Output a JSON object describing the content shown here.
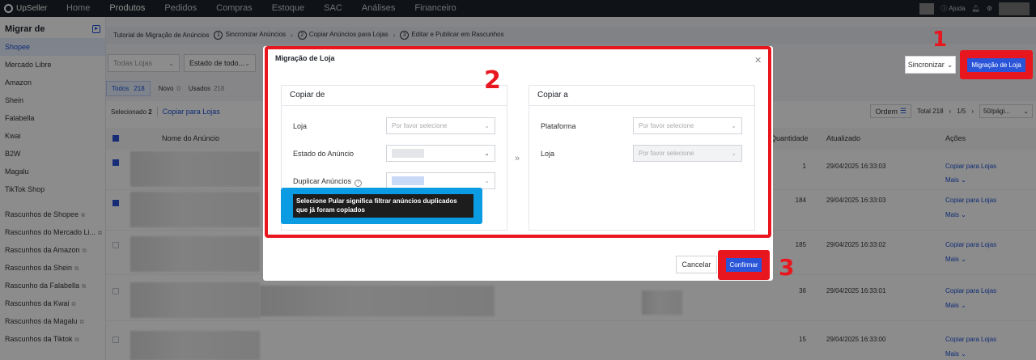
{
  "topnav": {
    "brand": "UpSeller",
    "items": [
      "Home",
      "Produtos",
      "Pedidos",
      "Compras",
      "Estoque",
      "SAC",
      "Análises",
      "Financeiro"
    ],
    "active": "Produtos",
    "help": "Ajuda"
  },
  "sidebar": {
    "title": "Migrar de",
    "platforms": [
      "Shopee",
      "Mercado Libre",
      "Amazon",
      "Shein",
      "Falabella",
      "Kwai",
      "B2W",
      "Magalu",
      "TikTok Shop"
    ],
    "drafts": [
      "Rascunhos de Shopee",
      "Rascunhos do Mercado Li...",
      "Rascunhos da Amazon",
      "Rascunhos da Shein",
      "Rascunho da Falabella",
      "Rascunhos da Kwai",
      "Rascunhos da Magalu",
      "Rascunhos da Tiktok"
    ]
  },
  "breadcrumb": {
    "tutorial": "Tutorial de Migração de Anúncios",
    "steps": [
      {
        "num": "1",
        "label": "Sincronizar Anúncios"
      },
      {
        "num": "2",
        "label": "Copiar Anúncios para Lojas"
      },
      {
        "num": "3",
        "label": "Editar e Publicar em Rascunhos"
      }
    ]
  },
  "filters": {
    "store": "Todas Lojas",
    "status": "Estado de todo..."
  },
  "toolbar": {
    "sync_label": "Sincronizar",
    "migrate_label": "Migração de Loja"
  },
  "tabs": {
    "all_label": "Todos",
    "all_count": "218",
    "new_label": "Novo",
    "new_count": "0",
    "used_label": "Usados",
    "used_count": "218"
  },
  "table": {
    "selected_label": "Selecionado",
    "selected_count": "2",
    "copy_link": "Copiar para Lojas",
    "order_label": "Ordem",
    "total_label": "Total 218",
    "page": "1/5",
    "page_size": "50/pági...",
    "headers": {
      "name": "Nome do Anúncio",
      "qty": "Quantidade",
      "updated": "Atualizado",
      "actions": "Ações"
    },
    "rows": [
      {
        "qty": "1",
        "updated": "29/04/2025 16:33:03",
        "checked": true
      },
      {
        "qty": "184",
        "updated": "29/04/2025 16:33:03",
        "checked": true
      },
      {
        "qty": "185",
        "updated": "29/04/2025 16:33:02",
        "checked": false
      },
      {
        "qty": "36",
        "updated": "29/04/2025 16:33:01",
        "checked": false
      },
      {
        "qty": "15",
        "updated": "29/04/2025 16:33:00",
        "checked": false
      }
    ],
    "action_copy": "Copiar para Lojas",
    "action_more": "Mais"
  },
  "modal": {
    "title": "Migração de Loja",
    "copy_from": {
      "heading": "Copiar de",
      "store_label": "Loja",
      "store_placeholder": "Por favor selecione",
      "status_label": "Estado do Anúncio",
      "dup_label": "Duplicar Anúncios"
    },
    "copy_to": {
      "heading": "Copiar a",
      "platform_label": "Plataforma",
      "platform_placeholder": "Por favor selecione",
      "store_label": "Loja",
      "store_placeholder": "Por favor selecione"
    },
    "tooltip": "Selecione Pular significa filtrar anúncios duplicados que já foram copiados",
    "cancel_label": "Cancelar",
    "confirm_label": "Confirmar"
  },
  "annotations": {
    "n1": "1",
    "n2": "2",
    "n3": "3"
  },
  "colors": {
    "accent": "#2a55d8",
    "highlight": "#e8161e",
    "tooltip_frame": "#0a9be3"
  }
}
